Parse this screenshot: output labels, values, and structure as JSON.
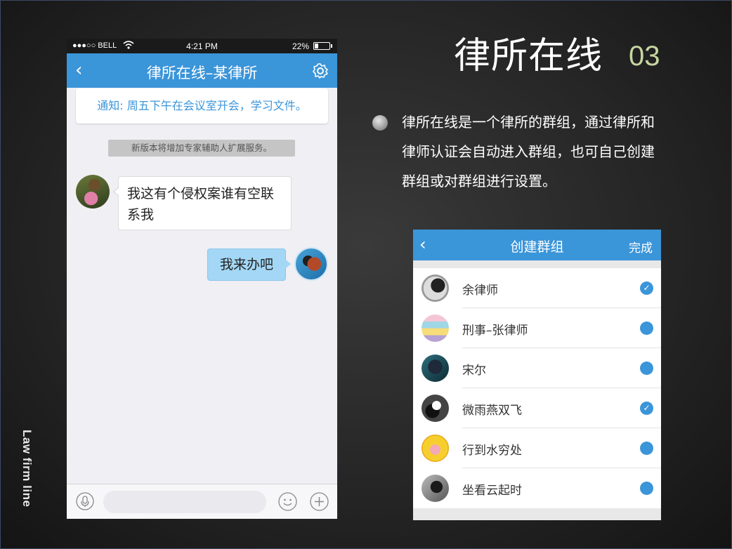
{
  "side_label": "Law firm line",
  "phone": {
    "status": {
      "carrier": "●●●○○ BELL",
      "time": "4:21 PM",
      "battery": "22%"
    },
    "nav": {
      "title": "律所在线–某律所"
    },
    "notice": "通知: 周五下午在会议室开会，学习文件。",
    "system_message": "新版本将增加专家辅助人扩展服务。",
    "messages": [
      {
        "side": "in",
        "text": "我这有个侵权案谁有空联系我"
      },
      {
        "side": "out",
        "text": "我来办吧"
      }
    ],
    "input": {
      "placeholder": ""
    }
  },
  "heading": {
    "title": "律所在线",
    "number": "03"
  },
  "description": "律所在线是一个律所的群组，通过律所和律师认证会自动进入群组，也可自己创建群组或对群组进行设置。",
  "create_group": {
    "title": "创建群组",
    "done_label": "完成",
    "members": [
      {
        "name": "余律师",
        "checked": true
      },
      {
        "name": "刑事–张律师",
        "checked": false
      },
      {
        "name": "宋尔",
        "checked": false
      },
      {
        "name": "微雨燕双飞",
        "checked": true
      },
      {
        "name": "行到水穷处",
        "checked": false
      },
      {
        "name": "坐看云起时",
        "checked": false
      }
    ]
  },
  "colors": {
    "accent": "#3b95d9",
    "number": "#c6d6a0",
    "outgoing_bubble": "#a3d7f5"
  }
}
